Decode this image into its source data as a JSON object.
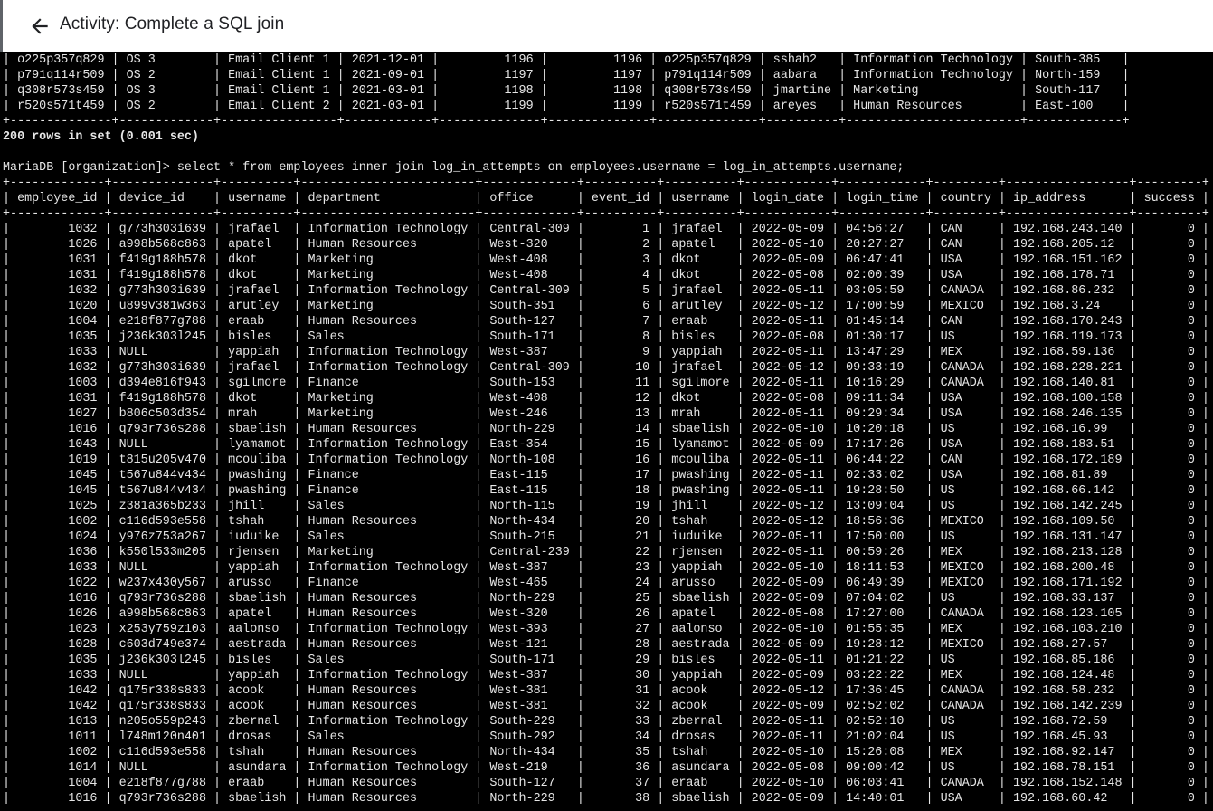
{
  "header": {
    "title": "Activity: Complete a SQL join",
    "back_icon": "arrow-left-icon"
  },
  "terminal": {
    "lines": [
      "| o225p357q829 | OS 3        | Email Client 1 | 2021-12-01 |         1196 |         1196 | o225p357q829 | sshah2   | Information Technology | South-385   |",
      "| p791q114r509 | OS 2        | Email Client 1 | 2021-09-01 |         1197 |         1197 | p791q114r509 | aabara   | Information Technology | North-159   |",
      "| q308r573s459 | OS 3        | Email Client 1 | 2021-03-01 |         1198 |         1198 | q308r573s459 | jmartine | Marketing              | South-117   |",
      "| r520s571t459 | OS 2        | Email Client 2 | 2021-03-01 |         1199 |         1199 | r520s571t459 | areyes   | Human Resources        | East-100    |",
      "+--------------+-------------+----------------+------------+--------------+--------------+--------------+----------+------------------------+-------------+",
      "200 rows in set (0.001 sec)",
      "",
      "MariaDB [organization]> select * from employees inner join log_in_attempts on employees.username = log_in_attempts.username;",
      "+-------------+--------------+----------+------------------------+-------------+----------+----------+------------+------------+---------+-----------------+---------+",
      "| employee_id | device_id    | username | department             | office      | event_id | username | login_date | login_time | country | ip_address      | success |",
      "+-------------+--------------+----------+------------------------+-------------+----------+----------+------------+------------+---------+-----------------+---------+",
      "|        1032 | g773h303i639 | jrafael  | Information Technology | Central-309 |        1 | jrafael  | 2022-05-09 | 04:56:27   | CAN     | 192.168.243.140 |       0 |",
      "|        1026 | a998b568c863 | apatel   | Human Resources        | West-320    |        2 | apatel   | 2022-05-10 | 20:27:27   | CAN     | 192.168.205.12  |       0 |",
      "|        1031 | f419g188h578 | dkot     | Marketing              | West-408    |        3 | dkot     | 2022-05-09 | 06:47:41   | USA     | 192.168.151.162 |       0 |",
      "|        1031 | f419g188h578 | dkot     | Marketing              | West-408    |        4 | dkot     | 2022-05-08 | 02:00:39   | USA     | 192.168.178.71  |       0 |",
      "|        1032 | g773h303i639 | jrafael  | Information Technology | Central-309 |        5 | jrafael  | 2022-05-11 | 03:05:59   | CANADA  | 192.168.86.232  |       0 |",
      "|        1020 | u899v381w363 | arutley  | Marketing              | South-351   |        6 | arutley  | 2022-05-12 | 17:00:59   | MEXICO  | 192.168.3.24    |       0 |",
      "|        1004 | e218f877g788 | eraab    | Human Resources        | South-127   |        7 | eraab    | 2022-05-11 | 01:45:14   | CAN     | 192.168.170.243 |       0 |",
      "|        1035 | j236k303l245 | bisles   | Sales                  | South-171   |        8 | bisles   | 2022-05-08 | 01:30:17   | US      | 192.168.119.173 |       0 |",
      "|        1033 | NULL         | yappiah  | Information Technology | West-387    |        9 | yappiah  | 2022-05-11 | 13:47:29   | MEX     | 192.168.59.136  |       0 |",
      "|        1032 | g773h303i639 | jrafael  | Information Technology | Central-309 |       10 | jrafael  | 2022-05-12 | 09:33:19   | CANADA  | 192.168.228.221 |       0 |",
      "|        1003 | d394e816f943 | sgilmore | Finance                | South-153   |       11 | sgilmore | 2022-05-11 | 10:16:29   | CANADA  | 192.168.140.81  |       0 |",
      "|        1031 | f419g188h578 | dkot     | Marketing              | West-408    |       12 | dkot     | 2022-05-08 | 09:11:34   | USA     | 192.168.100.158 |       0 |",
      "|        1027 | b806c503d354 | mrah     | Marketing              | West-246    |       13 | mrah     | 2022-05-11 | 09:29:34   | USA     | 192.168.246.135 |       0 |",
      "|        1016 | q793r736s288 | sbaelish | Human Resources        | North-229   |       14 | sbaelish | 2022-05-10 | 10:20:18   | US      | 192.168.16.99   |       0 |",
      "|        1043 | NULL         | lyamamot | Information Technology | East-354    |       15 | lyamamot | 2022-05-09 | 17:17:26   | USA     | 192.168.183.51  |       0 |",
      "|        1019 | t815u205v470 | mcouliba | Information Technology | North-108   |       16 | mcouliba | 2022-05-11 | 06:44:22   | CAN     | 192.168.172.189 |       0 |",
      "|        1045 | t567u844v434 | pwashing | Finance                | East-115    |       17 | pwashing | 2022-05-11 | 02:33:02   | USA     | 192.168.81.89   |       0 |",
      "|        1045 | t567u844v434 | pwashing | Finance                | East-115    |       18 | pwashing | 2022-05-11 | 19:28:50   | US      | 192.168.66.142  |       0 |",
      "|        1025 | z381a365b233 | jhill    | Sales                  | North-115   |       19 | jhill    | 2022-05-12 | 13:09:04   | US      | 192.168.142.245 |       0 |",
      "|        1002 | c116d593e558 | tshah    | Human Resources        | North-434   |       20 | tshah    | 2022-05-12 | 18:56:36   | MEXICO  | 192.168.109.50  |       0 |",
      "|        1024 | y976z753a267 | iuduike  | Sales                  | South-215   |       21 | iuduike  | 2022-05-11 | 17:50:00   | US      | 192.168.131.147 |       0 |",
      "|        1036 | k550l533m205 | rjensen  | Marketing              | Central-239 |       22 | rjensen  | 2022-05-11 | 00:59:26   | MEX     | 192.168.213.128 |       0 |",
      "|        1033 | NULL         | yappiah  | Information Technology | West-387    |       23 | yappiah  | 2022-05-10 | 18:11:53   | MEXICO  | 192.168.200.48  |       0 |",
      "|        1022 | w237x430y567 | arusso   | Finance                | West-465    |       24 | arusso   | 2022-05-09 | 06:49:39   | MEXICO  | 192.168.171.192 |       0 |",
      "|        1016 | q793r736s288 | sbaelish | Human Resources        | North-229   |       25 | sbaelish | 2022-05-09 | 07:04:02   | US      | 192.168.33.137  |       0 |",
      "|        1026 | a998b568c863 | apatel   | Human Resources        | West-320    |       26 | apatel   | 2022-05-08 | 17:27:00   | CANADA  | 192.168.123.105 |       0 |",
      "|        1023 | x253y759z103 | aalonso  | Information Technology | West-393    |       27 | aalonso  | 2022-05-10 | 01:55:35   | MEX     | 192.168.103.210 |       0 |",
      "|        1028 | c603d749e374 | aestrada | Human Resources        | West-121    |       28 | aestrada | 2022-05-09 | 19:28:12   | MEXICO  | 192.168.27.57   |       0 |",
      "|        1035 | j236k303l245 | bisles   | Sales                  | South-171   |       29 | bisles   | 2022-05-11 | 01:21:22   | US      | 192.168.85.186  |       0 |",
      "|        1033 | NULL         | yappiah  | Information Technology | West-387    |       30 | yappiah  | 2022-05-09 | 03:22:22   | MEX     | 192.168.124.48  |       0 |",
      "|        1042 | q175r338s833 | acook    | Human Resources        | West-381    |       31 | acook    | 2022-05-12 | 17:36:45   | CANADA  | 192.168.58.232  |       0 |",
      "|        1042 | q175r338s833 | acook    | Human Resources        | West-381    |       32 | acook    | 2022-05-09 | 02:52:02   | CANADA  | 192.168.142.239 |       0 |",
      "|        1013 | n205o559p243 | zbernal  | Information Technology | South-229   |       33 | zbernal  | 2022-05-11 | 02:52:10   | US      | 192.168.72.59   |       0 |",
      "|        1011 | l748m120n401 | drosas   | Sales                  | South-292   |       34 | drosas   | 2022-05-11 | 21:02:04   | US      | 192.168.45.93   |       0 |",
      "|        1002 | c116d593e558 | tshah    | Human Resources        | North-434   |       35 | tshah    | 2022-05-10 | 15:26:08   | MEX     | 192.168.92.147  |       0 |",
      "|        1014 | NULL         | asundara | Information Technology | West-219    |       36 | asundara | 2022-05-08 | 09:00:42   | US      | 192.168.78.151  |       0 |",
      "|        1004 | e218f877g788 | eraab    | Human Resources        | South-127   |       37 | eraab    | 2022-05-10 | 06:03:41   | CANADA  | 192.168.152.148 |       0 |",
      "|        1016 | q793r736s288 | sbaelish | Human Resources        | North-229   |       38 | sbaelish | 2022-05-09 | 14:40:01   | USA     | 192.168.60.42   |       0 |"
    ]
  }
}
